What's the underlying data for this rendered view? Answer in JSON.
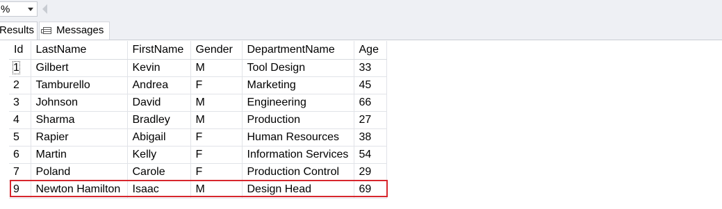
{
  "zoom": {
    "value": "%"
  },
  "tabs": [
    {
      "label": "Results"
    },
    {
      "label": "Messages"
    }
  ],
  "grid": {
    "columns": [
      "Id",
      "LastName",
      "FirstName",
      "Gender",
      "DepartmentName",
      "Age"
    ],
    "rows": [
      [
        "1",
        "Gilbert",
        "Kevin",
        "M",
        "Tool Design",
        "33"
      ],
      [
        "2",
        "Tamburello",
        "Andrea",
        "F",
        "Marketing",
        "45"
      ],
      [
        "3",
        "Johnson",
        "David",
        "M",
        "Engineering",
        "66"
      ],
      [
        "4",
        "Sharma",
        "Bradley",
        "M",
        "Production",
        "27"
      ],
      [
        "5",
        "Rapier",
        "Abigail",
        "F",
        "Human Resources",
        "38"
      ],
      [
        "6",
        "Martin",
        "Kelly",
        "F",
        "Information Services",
        "54"
      ],
      [
        "7",
        "Poland",
        "Carole",
        "F",
        "Production Control",
        "29"
      ],
      [
        "9",
        "Newton Hamilton",
        "Isaac",
        "M",
        "Design Head",
        "69"
      ]
    ]
  },
  "colors": {
    "highlight": "#d7262d",
    "toolbar_bg": "#eef0f4"
  }
}
